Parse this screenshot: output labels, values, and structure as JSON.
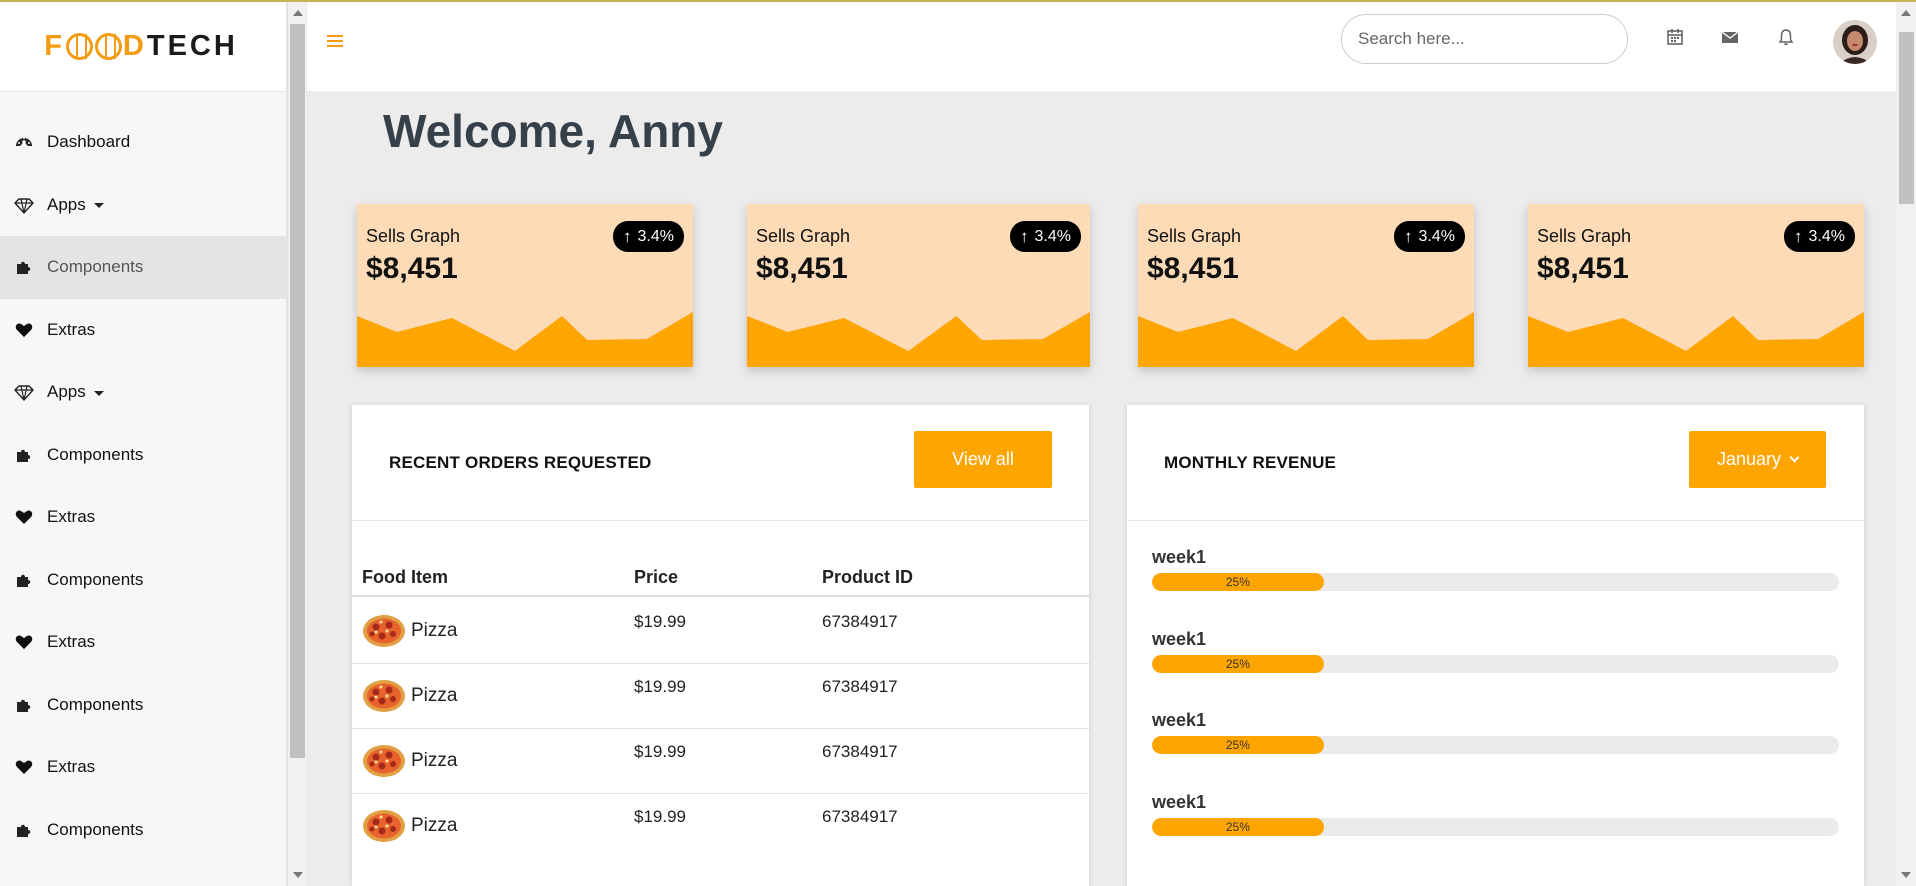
{
  "brand": {
    "logo_text_1": "F",
    "logo_text_2": "TECH"
  },
  "sidebar": {
    "items": [
      {
        "label": "Dashboard",
        "icon": "dashboard-icon"
      },
      {
        "label": "Apps",
        "icon": "diamond-icon",
        "has_caret": true
      },
      {
        "label": "Components",
        "icon": "puzzle-icon",
        "active": true
      },
      {
        "label": "Extras",
        "icon": "heart-icon"
      },
      {
        "label": "Apps",
        "icon": "diamond-icon",
        "has_caret": true
      },
      {
        "label": "Components",
        "icon": "puzzle-icon"
      },
      {
        "label": "Extras",
        "icon": "heart-icon"
      },
      {
        "label": "Components",
        "icon": "puzzle-icon"
      },
      {
        "label": "Extras",
        "icon": "heart-icon"
      },
      {
        "label": "Components",
        "icon": "puzzle-icon"
      },
      {
        "label": "Extras",
        "icon": "heart-icon"
      },
      {
        "label": "Components",
        "icon": "puzzle-icon"
      }
    ]
  },
  "header": {
    "search_placeholder": "Search here...",
    "icons": [
      "calendar-icon",
      "envelope-icon",
      "bell-icon"
    ],
    "accent_color": "#f39c12"
  },
  "main": {
    "welcome": "Welcome, Anny",
    "stat_cards": [
      {
        "label": "Sells Graph",
        "value": "$8,451",
        "change": "3.4%"
      },
      {
        "label": "Sells Graph",
        "value": "$8,451",
        "change": "3.4%"
      },
      {
        "label": "Sells Graph",
        "value": "$8,451",
        "change": "3.4%"
      },
      {
        "label": "Sells Graph",
        "value": "$8,451",
        "change": "3.4%"
      }
    ],
    "orders": {
      "title": "RECENT ORDERS REQUESTED",
      "button": "View all",
      "columns": [
        "Food Item",
        "Price",
        "Product ID"
      ],
      "rows": [
        {
          "item": "Pizza",
          "price": "$19.99",
          "product_id": "67384917"
        },
        {
          "item": "Pizza",
          "price": "$19.99",
          "product_id": "67384917"
        },
        {
          "item": "Pizza",
          "price": "$19.99",
          "product_id": "67384917"
        },
        {
          "item": "Pizza",
          "price": "$19.99",
          "product_id": "67384917"
        }
      ]
    },
    "revenue": {
      "title": "MONTHLY REVENUE",
      "dropdown": "January",
      "weeks": [
        {
          "label": "week1",
          "percent_text": "25%",
          "fill": 0.25
        },
        {
          "label": "week1",
          "percent_text": "25%",
          "fill": 0.25
        },
        {
          "label": "week1",
          "percent_text": "25%",
          "fill": 0.25
        },
        {
          "label": "week1",
          "percent_text": "25%",
          "fill": 0.25
        }
      ]
    }
  },
  "colors": {
    "accent": "#ffa500",
    "card_bg": "#fddbb7",
    "badge_bg": "#000000"
  }
}
